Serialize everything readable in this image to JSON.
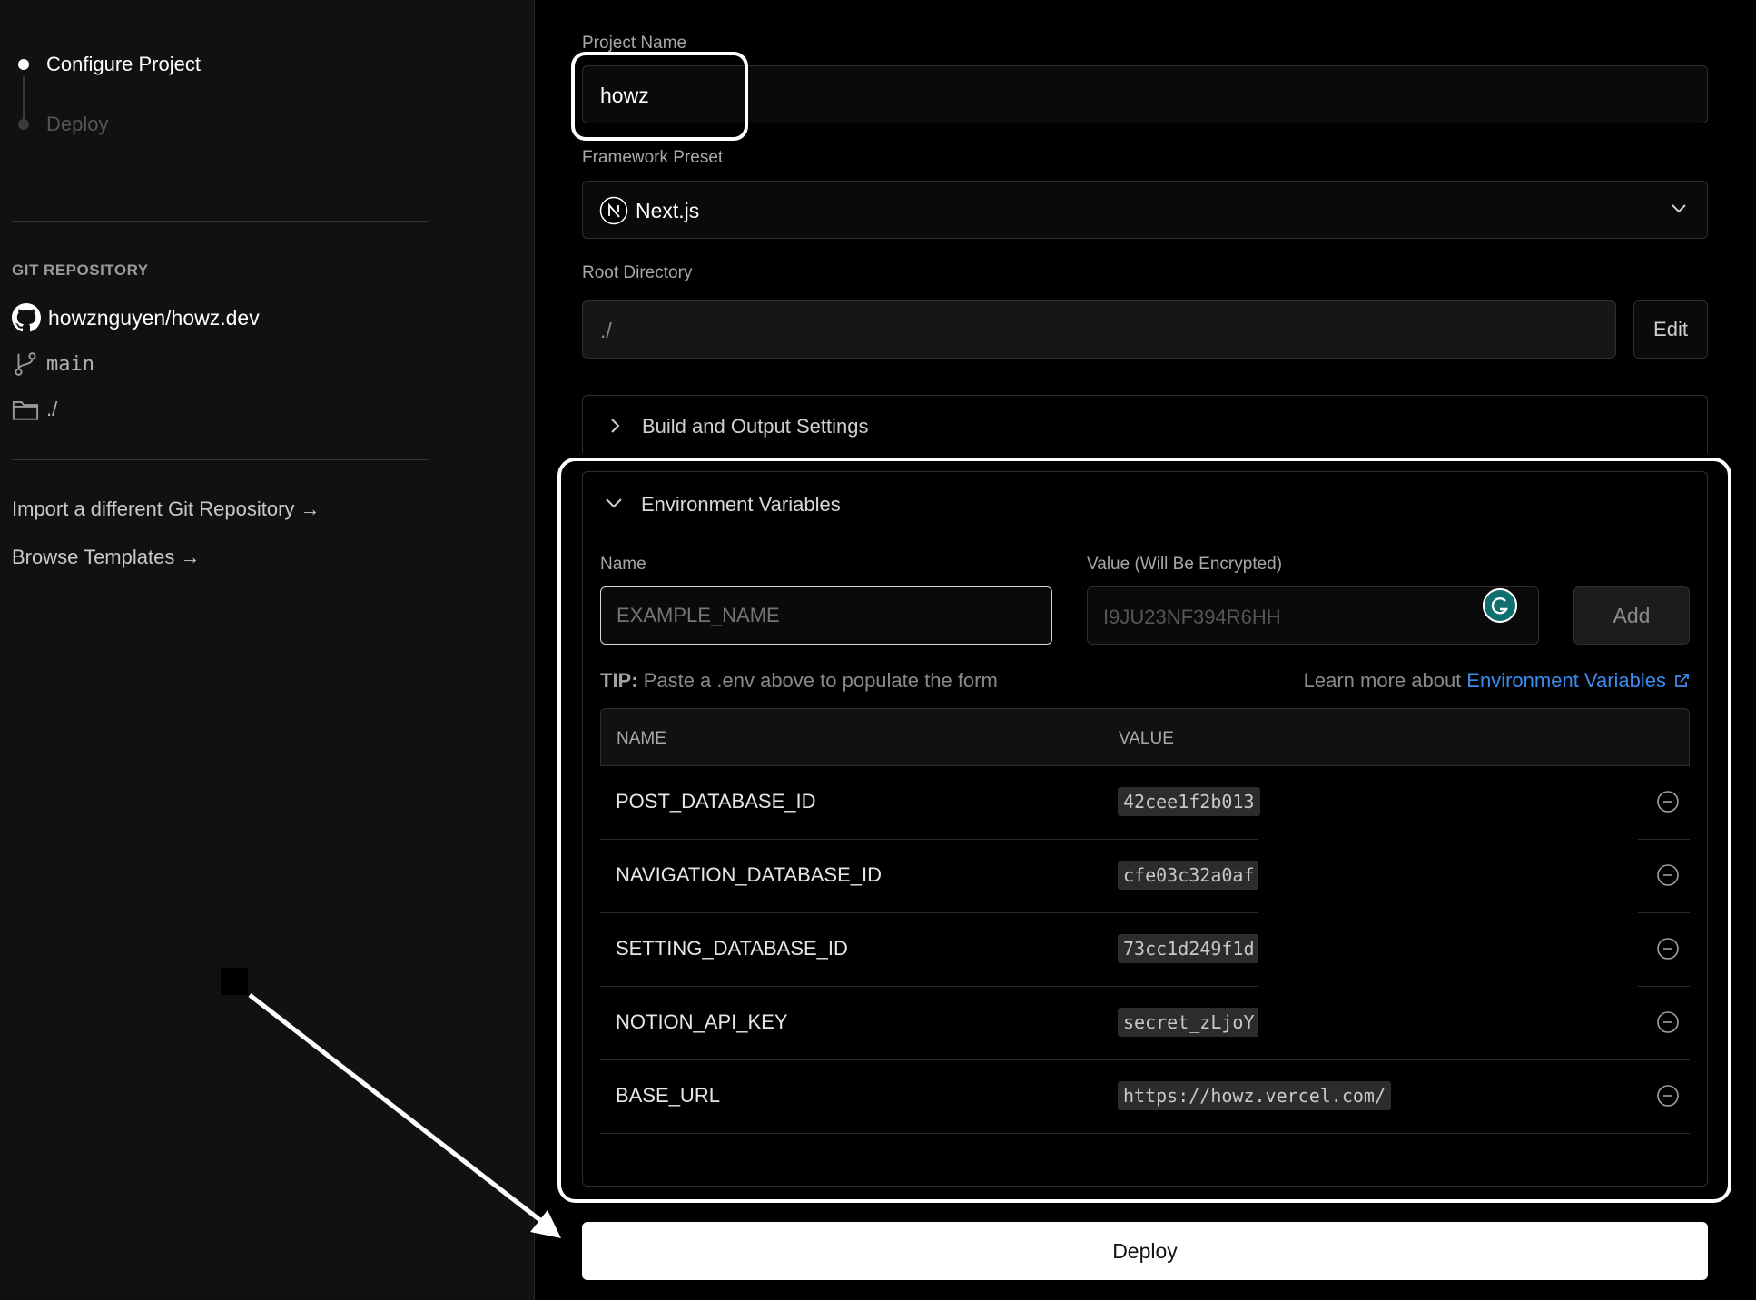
{
  "steps": [
    {
      "label": "Configure Project",
      "state": "active"
    },
    {
      "label": "Deploy",
      "state": "pending"
    }
  ],
  "git": {
    "section_title": "GIT REPOSITORY",
    "repo": "howznguyen/howz.dev",
    "branch": "main",
    "directory": "./"
  },
  "links": {
    "import_repo": "Import a different Git Repository →",
    "browse_templates": "Browse Templates →"
  },
  "form": {
    "project_name_label": "Project Name",
    "project_name_value": "howz",
    "framework_label": "Framework Preset",
    "framework_value": "Next.js",
    "root_dir_label": "Root Directory",
    "root_dir_value": "./",
    "edit_label": "Edit",
    "build_settings_label": "Build and Output Settings"
  },
  "env": {
    "title": "Environment Variables",
    "name_label": "Name",
    "value_label": "Value (Will Be Encrypted)",
    "name_placeholder": "EXAMPLE_NAME",
    "value_placeholder": "I9JU23NF394R6HH",
    "add_label": "Add",
    "tip_prefix": "TIP:",
    "tip_text": " Paste a .env above to populate the form",
    "learn_more_text": "Learn more about ",
    "learn_more_link": "Environment Variables",
    "table_headers": {
      "name": "NAME",
      "value": "VALUE"
    },
    "rows": [
      {
        "name": "POST_DATABASE_ID",
        "value": "42cee1f2b013"
      },
      {
        "name": "NAVIGATION_DATABASE_ID",
        "value": "cfe03c32a0af"
      },
      {
        "name": "SETTING_DATABASE_ID",
        "value": "73cc1d249f1d"
      },
      {
        "name": "NOTION_API_KEY",
        "value": "secret_zLjoY"
      },
      {
        "name": "BASE_URL",
        "value": "https://howz.vercel.com/"
      }
    ]
  },
  "deploy_label": "Deploy",
  "colors": {
    "link": "#3b8cf0",
    "background": "#000000",
    "sidebar": "#111111"
  }
}
